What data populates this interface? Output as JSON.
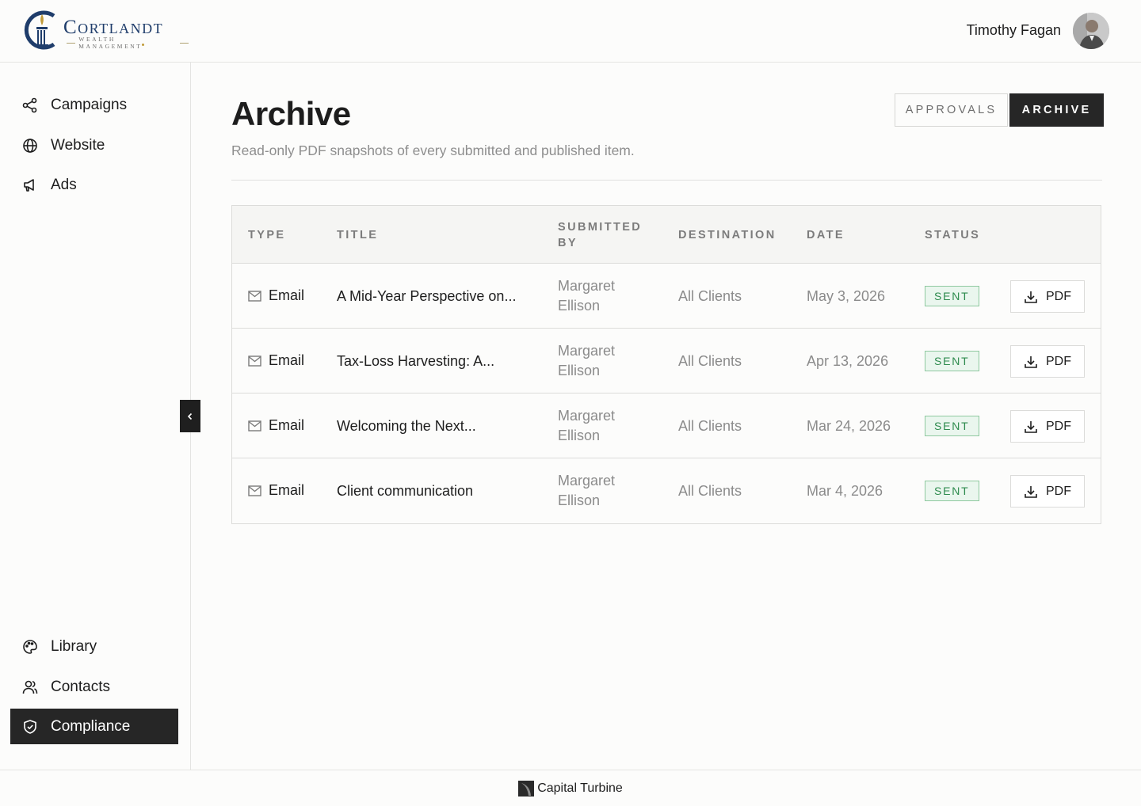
{
  "brand": {
    "name": "Cortlandt",
    "tagline": "WEALTH MANAGEMENT"
  },
  "user": {
    "name": "Timothy Fagan"
  },
  "sidebar": {
    "top_items": [
      {
        "label": "Campaigns",
        "icon": "share-icon"
      },
      {
        "label": "Website",
        "icon": "globe-icon"
      },
      {
        "label": "Ads",
        "icon": "megaphone-icon"
      }
    ],
    "bottom_items": [
      {
        "label": "Library",
        "icon": "palette-icon"
      },
      {
        "label": "Contacts",
        "icon": "users-icon"
      },
      {
        "label": "Compliance",
        "icon": "shield-check-icon",
        "active": true
      }
    ]
  },
  "page": {
    "title": "Archive",
    "subtitle": "Read-only PDF snapshots of every submitted and published item."
  },
  "segments": {
    "approvals": "APPROVALS",
    "archive": "ARCHIVE",
    "active": "archive"
  },
  "table": {
    "headers": {
      "type": "TYPE",
      "title": "TITLE",
      "submitted_by": "SUBMITTED BY",
      "destination": "DESTINATION",
      "date": "DATE",
      "status": "STATUS"
    },
    "rows": [
      {
        "type": "Email",
        "title": "A Mid-Year Perspective on...",
        "submitted_by": "Margaret Ellison",
        "destination": "All Clients",
        "date": "May 3, 2026",
        "status": "SENT",
        "action": "PDF"
      },
      {
        "type": "Email",
        "title": "Tax-Loss Harvesting: A...",
        "submitted_by": "Margaret Ellison",
        "destination": "All Clients",
        "date": "Apr 13, 2026",
        "status": "SENT",
        "action": "PDF"
      },
      {
        "type": "Email",
        "title": "Welcoming the Next...",
        "submitted_by": "Margaret Ellison",
        "destination": "All Clients",
        "date": "Mar 24, 2026",
        "status": "SENT",
        "action": "PDF"
      },
      {
        "type": "Email",
        "title": "Client communication",
        "submitted_by": "Margaret Ellison",
        "destination": "All Clients",
        "date": "Mar 4, 2026",
        "status": "SENT",
        "action": "PDF"
      }
    ]
  },
  "footer": {
    "text": "Capital Turbine"
  },
  "colors": {
    "brand_navy": "#1f3d6b",
    "active_nav": "#262626",
    "status_green": "#2e8b4e"
  }
}
